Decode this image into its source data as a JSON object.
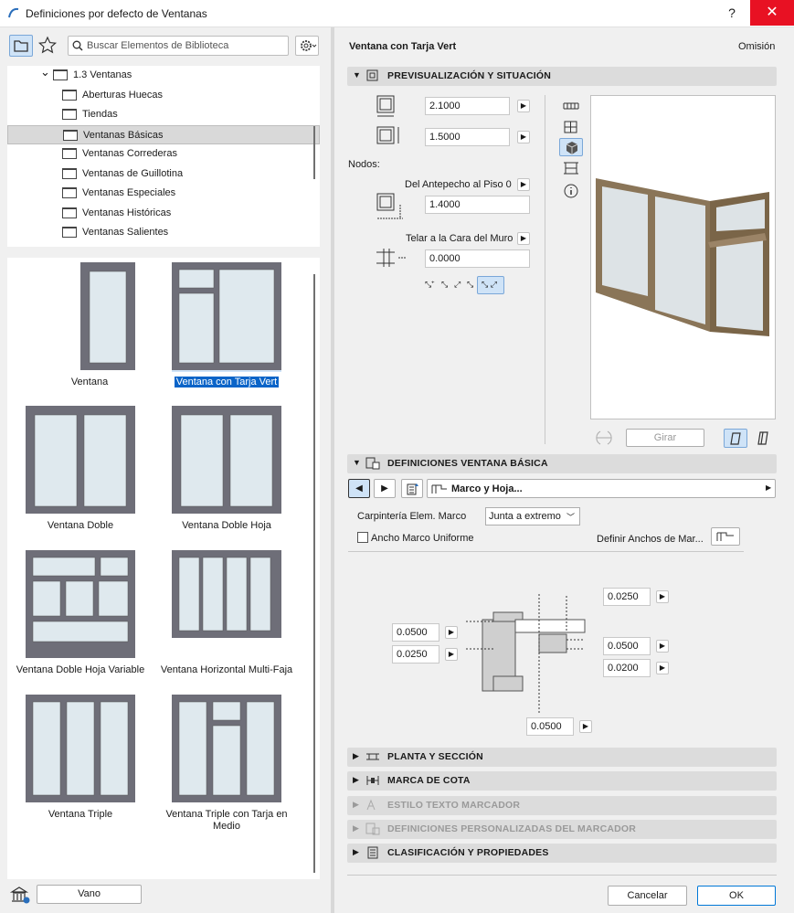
{
  "window": {
    "title": "Definiciones por defecto de Ventanas",
    "help": "?",
    "close": "✕"
  },
  "library": {
    "search_placeholder": "Buscar Elementos de Biblioteca",
    "tree": [
      {
        "label": "1.3 Ventanas",
        "indent": 0,
        "expanded": true
      },
      {
        "label": "Aberturas Huecas",
        "indent": 1
      },
      {
        "label": "Tiendas",
        "indent": 1
      },
      {
        "label": "Ventanas Básicas",
        "indent": 1,
        "selected": true
      },
      {
        "label": "Ventanas Correderas",
        "indent": 1
      },
      {
        "label": "Ventanas de Guillotina",
        "indent": 1
      },
      {
        "label": "Ventanas Especiales",
        "indent": 1
      },
      {
        "label": "Ventanas Históricas",
        "indent": 1
      },
      {
        "label": "Ventanas Salientes",
        "indent": 1
      }
    ],
    "items": [
      {
        "label": "Ventana",
        "type": "single"
      },
      {
        "label": "Ventana con Tarja Vert",
        "type": "tarja",
        "selected": true
      },
      {
        "label": "Ventana Doble",
        "type": "double"
      },
      {
        "label": "Ventana Doble Hoja",
        "type": "double"
      },
      {
        "label": "Ventana Doble Hoja Variable",
        "type": "variable"
      },
      {
        "label": "Ventana Horizontal Multi-Faja",
        "type": "multi"
      },
      {
        "label": "Ventana Triple",
        "type": "triple"
      },
      {
        "label": "Ventana Triple con Tarja en Medio",
        "type": "triplemid"
      }
    ],
    "vano_label": "Vano"
  },
  "header": {
    "title": "Ventana con Tarja Vert",
    "right": "Omisión"
  },
  "sections": {
    "preview": "PREVISUALIZACIÓN Y SITUACIÓN",
    "basic": "DEFINICIONES VENTANA BÁSICA",
    "plan": "PLANTA Y SECCIÓN",
    "dim": "MARCA DE COTA",
    "text": "ESTILO TEXTO MARCADOR",
    "custom": "DEFINICIONES PERSONALIZADAS DEL MARCADOR",
    "class": "CLASIFICACIÓN Y PROPIEDADES"
  },
  "preview": {
    "width": "2.1000",
    "height": "1.5000",
    "nodos_label": "Nodos:",
    "sill_label": "Del Antepecho al Piso 0",
    "sill_value": "1.4000",
    "reveal_label": "Telar a la Cara del Muro",
    "reveal_value": "0.0000",
    "rotate_label": "Girar"
  },
  "basic": {
    "page_label": "Marco y Hoja...",
    "frame_label": "Carpintería Elem. Marco",
    "frame_value": "Junta a extremo",
    "uniform_label": "Ancho Marco Uniforme",
    "define_label": "Definir Anchos de Mar...",
    "dims": {
      "top_right": "0.0250",
      "left_top": "0.0500",
      "left_bottom": "0.0250",
      "right_top": "0.0500",
      "right_bottom": "0.0200",
      "bottom": "0.0500"
    }
  },
  "footer": {
    "cancel": "Cancelar",
    "ok": "OK"
  },
  "colors": {
    "accent": "#0a64c8",
    "frame": "#6e6e78",
    "glass": "#dfe9ee",
    "wood": "#8a7558"
  }
}
